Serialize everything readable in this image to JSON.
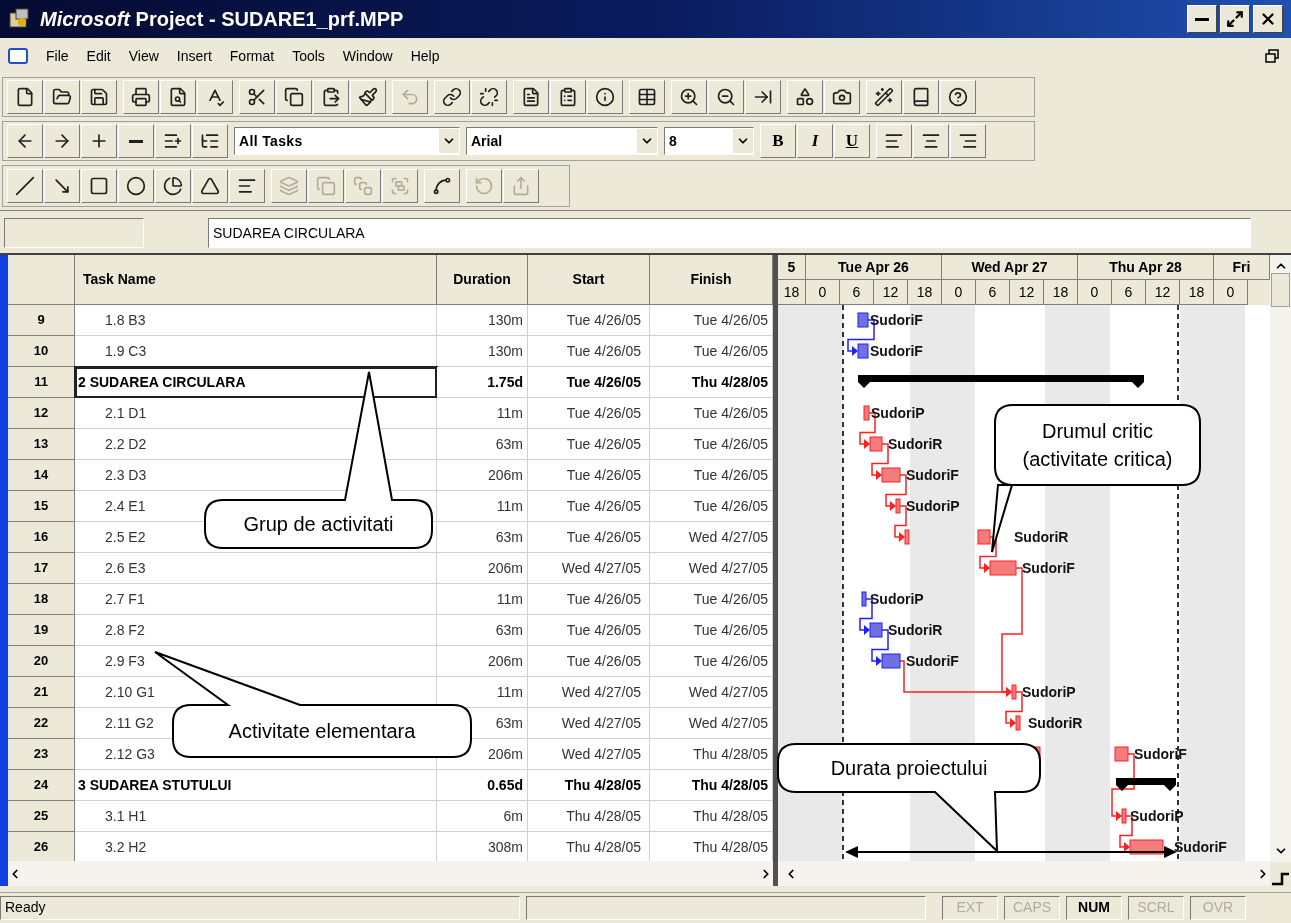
{
  "window": {
    "title": "*Microsoft* Project - SUDARE1_prf.MPP"
  },
  "menu": [
    "File",
    "Edit",
    "View",
    "Insert",
    "Format",
    "Tools",
    "Window",
    "Help"
  ],
  "toolbars": {
    "standard": [
      {
        "disabled": false
      },
      {
        "disabled": false
      },
      {
        "disabled": false
      },
      {
        "disabled": false
      },
      {
        "disabled": false
      },
      {
        "disabled": false
      },
      {
        "disabled": false
      },
      {
        "disabled": false
      },
      {
        "disabled": false
      },
      {
        "disabled": false
      },
      {
        "disabled": true
      },
      {
        "disabled": false
      },
      {
        "disabled": false
      },
      {
        "disabled": false
      },
      {
        "disabled": false
      },
      {
        "disabled": false
      },
      {
        "disabled": false
      },
      {
        "disabled": false
      },
      {
        "disabled": false
      },
      {
        "disabled": false
      },
      {
        "disabled": false
      },
      {
        "disabled": false
      },
      {
        "disabled": false
      },
      {
        "disabled": false
      },
      {
        "disabled": false
      }
    ],
    "formatting": {
      "filter": "All Tasks",
      "font": "Arial",
      "size": "8",
      "bold": "B",
      "italic": "I",
      "underline": "U"
    },
    "drawing": [
      {
        "disabled": false
      },
      {
        "disabled": false
      },
      {
        "disabled": false
      },
      {
        "disabled": false
      },
      {
        "disabled": false
      },
      {
        "disabled": false
      },
      {
        "disabled": false
      },
      {
        "disabled": true
      },
      {
        "disabled": true
      },
      {
        "disabled": true
      },
      {
        "disabled": true
      },
      {
        "disabled": false
      },
      {
        "disabled": true
      },
      {
        "disabled": true
      }
    ]
  },
  "entry_bar": {
    "value": "SUDAREA CIRCULARA"
  },
  "table": {
    "columns": [
      "Task Name",
      "Duration",
      "Start",
      "Finish"
    ],
    "rows": [
      {
        "id": "9",
        "name": "1.8 B3",
        "duration": "130m",
        "start": "Tue 4/26/05",
        "finish": "Tue 4/26/05",
        "kind": "task",
        "selected": false,
        "bar": {
          "label": "SudoriF",
          "critical": false
        }
      },
      {
        "id": "10",
        "name": "1.9 C3",
        "duration": "130m",
        "start": "Tue 4/26/05",
        "finish": "Tue 4/26/05",
        "kind": "task",
        "selected": false,
        "bar": {
          "label": "SudoriF",
          "critical": false
        }
      },
      {
        "id": "11",
        "name": "2 SUDAREA CIRCULARA",
        "duration": "1.75d",
        "start": "Tue 4/26/05",
        "finish": "Thu 4/28/05",
        "kind": "summary",
        "selected": true,
        "children": [
          {
            "id": "12",
            "name": "2.1 D1",
            "duration": "11m",
            "start": "Tue 4/26/05",
            "finish": "Tue 4/26/05",
            "kind": "task",
            "selected": false,
            "bar": {
              "label": "SudoriP",
              "critical": true
            }
          },
          {
            "id": "13",
            "name": "2.2 D2",
            "duration": "63m",
            "start": "Tue 4/26/05",
            "finish": "Tue 4/26/05",
            "kind": "task",
            "selected": false,
            "bar": {
              "label": "SudoriR",
              "critical": true
            }
          },
          {
            "id": "14",
            "name": "2.3 D3",
            "duration": "206m",
            "start": "Tue 4/26/05",
            "finish": "Tue 4/26/05",
            "kind": "task",
            "selected": false,
            "bar": {
              "label": "SudoriF",
              "critical": true
            }
          },
          {
            "id": "15",
            "name": "2.4 E1",
            "duration": "11m",
            "start": "Tue 4/26/05",
            "finish": "Tue 4/26/05",
            "kind": "task",
            "selected": false,
            "bar": {
              "label": "SudoriP",
              "critical": true
            }
          },
          {
            "id": "16",
            "name": "2.5 E2",
            "duration": "63m",
            "start": "Tue 4/26/05",
            "finish": "Wed 4/27/05",
            "kind": "task",
            "selected": false,
            "bar": {
              "label": "SudoriR",
              "critical": true
            }
          },
          {
            "id": "17",
            "name": "2.6 E3",
            "duration": "206m",
            "start": "Wed 4/27/05",
            "finish": "Wed 4/27/05",
            "kind": "task",
            "selected": false,
            "bar": {
              "label": "SudoriF",
              "critical": true
            }
          },
          {
            "id": "18",
            "name": "2.7 F1",
            "duration": "11m",
            "start": "Tue 4/26/05",
            "finish": "Tue 4/26/05",
            "kind": "task",
            "selected": false,
            "bar": {
              "label": "SudoriP",
              "critical": false
            }
          },
          {
            "id": "19",
            "name": "2.8 F2",
            "duration": "63m",
            "start": "Tue 4/26/05",
            "finish": "Tue 4/26/05",
            "kind": "task",
            "selected": false,
            "bar": {
              "label": "SudoriR",
              "critical": false
            }
          },
          {
            "id": "20",
            "name": "2.9 F3",
            "duration": "206m",
            "start": "Tue 4/26/05",
            "finish": "Tue 4/26/05",
            "kind": "task",
            "selected": false,
            "bar": {
              "label": "SudoriF",
              "critical": false
            }
          },
          {
            "id": "21",
            "name": "2.10 G1",
            "duration": "11m",
            "start": "Wed 4/27/05",
            "finish": "Wed 4/27/05",
            "kind": "task",
            "selected": false,
            "bar": {
              "label": "SudoriP",
              "critical": true
            }
          },
          {
            "id": "22",
            "name": "2.11 G2",
            "duration": "63m",
            "start": "Wed 4/27/05",
            "finish": "Wed 4/27/05",
            "kind": "task",
            "selected": false,
            "bar": {
              "label": "SudoriR",
              "critical": true
            }
          },
          {
            "id": "23",
            "name": "2.12 G3",
            "duration": "206m",
            "start": "Wed 4/27/05",
            "finish": "Thu 4/28/05",
            "kind": "task",
            "selected": false,
            "bar": {
              "label": "SudoriF",
              "critical": true
            }
          }
        ]
      },
      {
        "id": "24",
        "name": "3 SUDAREA STUTULUI",
        "duration": "0.65d",
        "start": "Thu 4/28/05",
        "finish": "Thu 4/28/05",
        "kind": "summary",
        "selected": false,
        "children": [
          {
            "id": "25",
            "name": "3.1 H1",
            "duration": "6m",
            "start": "Thu 4/28/05",
            "finish": "Thu 4/28/05",
            "kind": "task",
            "selected": false,
            "bar": {
              "label": "SudoriP",
              "critical": true
            }
          },
          {
            "id": "26",
            "name": "3.2 H2",
            "duration": "308m",
            "start": "Thu 4/28/05",
            "finish": "Thu 4/28/05",
            "kind": "task",
            "selected": false,
            "bar": {
              "label": "SudoriF",
              "critical": true
            }
          }
        ]
      }
    ]
  },
  "timescale": {
    "major": [
      "5",
      "Tue Apr 26",
      "Wed Apr 27",
      "Thu Apr 28",
      "Fri"
    ],
    "minor": [
      "18",
      "0",
      "6",
      "12",
      "18",
      "0",
      "6",
      "12",
      "18",
      "0",
      "6",
      "12",
      "18",
      "0"
    ]
  },
  "callouts": [
    {
      "lines": [
        "Grup de activitati"
      ]
    },
    {
      "lines": [
        "Activitate elementara"
      ]
    },
    {
      "lines": [
        "Drumul critic",
        "(activitate critica)"
      ]
    },
    {
      "lines": [
        "Durata proiectului"
      ]
    }
  ],
  "status_bar": {
    "text": "Ready",
    "indicators": [
      {
        "label": "EXT",
        "on": false
      },
      {
        "label": "CAPS",
        "on": false
      },
      {
        "label": "NUM",
        "on": true
      },
      {
        "label": "SCRL",
        "on": false
      },
      {
        "label": "OVR",
        "on": false
      }
    ]
  }
}
